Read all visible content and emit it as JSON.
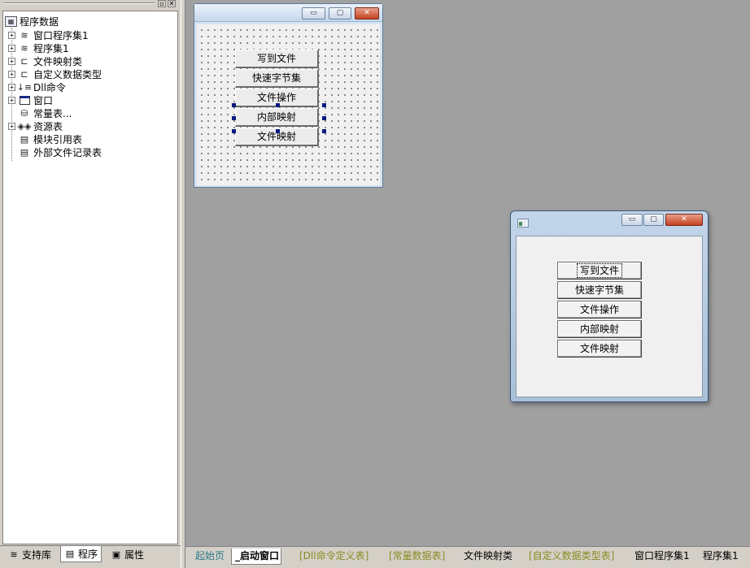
{
  "left_panel": {
    "titlebar_buttons": [
      "▫",
      "✕"
    ],
    "tree": {
      "root": "程序数据",
      "items": [
        {
          "label": "窗口程序集1",
          "expandable": true,
          "icon": "module-stack-icon"
        },
        {
          "label": "程序集1",
          "expandable": true,
          "icon": "module-stack-icon"
        },
        {
          "label": "文件映射类",
          "expandable": true,
          "icon": "class-icon"
        },
        {
          "label": "自定义数据类型",
          "expandable": true,
          "icon": "datatype-icon"
        },
        {
          "label": "Dll命令",
          "expandable": true,
          "icon": "dll-icon"
        },
        {
          "label": "窗口",
          "expandable": true,
          "icon": "window-icon"
        },
        {
          "label": "常量表...",
          "expandable": false,
          "icon": "constant-icon"
        },
        {
          "label": "资源表",
          "expandable": true,
          "icon": "resource-icon"
        },
        {
          "label": "模块引用表",
          "expandable": false,
          "icon": "module-ref-icon"
        },
        {
          "label": "外部文件记录表",
          "expandable": false,
          "icon": "external-file-icon"
        }
      ]
    },
    "tabs": [
      {
        "label": "支持库",
        "icon": "library-icon"
      },
      {
        "label": "程序",
        "icon": "program-icon",
        "active": true
      },
      {
        "label": "属性",
        "icon": "property-icon"
      }
    ]
  },
  "design_window": {
    "caption_buttons": [
      "▭",
      "▢",
      "✕"
    ],
    "buttons": [
      "写到文件",
      "快速字节集",
      "文件操作",
      "内部映射",
      "文件映射"
    ],
    "selected_button": "内部映射"
  },
  "run_window": {
    "caption_buttons": [
      "▭",
      "▢",
      "✕"
    ],
    "buttons": [
      "写到文件",
      "快速字节集",
      "文件操作",
      "内部映射",
      "文件映射"
    ],
    "focused_button": "写到文件"
  },
  "bottom_tabs": [
    {
      "label": "起始页",
      "color": "#2a7a8a"
    },
    {
      "label": "_启动窗口",
      "color": "#000000",
      "active": true
    },
    {
      "label": "[Dll命令定义表]",
      "color": "#8a8a20"
    },
    {
      "label": "[常量数据表]",
      "color": "#8a8a20"
    },
    {
      "label": "文件映射类",
      "color": "#000000"
    },
    {
      "label": "[自定义数据类型表]",
      "color": "#8a8a20"
    },
    {
      "label": "窗口程序集1",
      "color": "#000000"
    },
    {
      "label": "程序集1",
      "color": "#000000"
    }
  ]
}
